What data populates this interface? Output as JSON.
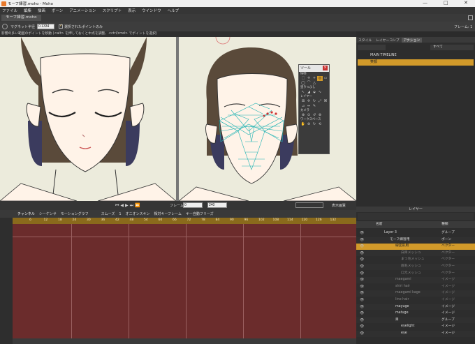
{
  "titlebar": {
    "title": "モーフ練習.moho - Moho",
    "minimize": "—",
    "maximize": "□",
    "close": "✕"
  },
  "menu": [
    "ファイル",
    "編集",
    "描画",
    "ボーン",
    "アニメーション",
    "スクリプト",
    "表示",
    "ウインドウ",
    "ヘルプ"
  ],
  "doc_tab": "モーフ練習.moho",
  "tool_options": {
    "magnet_label": "マグネット半径",
    "magnet_value": "0.1334",
    "selected_only_label": "選択されたポイントのみ"
  },
  "status_text": "影響の多い範囲のポイントを移動 (<alt> を押しておくと中点を調整、<ctrl/cmd> でポイントを選択)",
  "frame_readout": "フレーム: 1",
  "viewport_ctrl": {
    "frame_label": "フレーム",
    "frame_value": "0",
    "end_value": "240",
    "quality": "表示画質"
  },
  "timeline_tabs": [
    "チャンネル",
    "シーケンサ",
    "モーショングラフ",
    "スムーズ",
    "1",
    "オニオンスキン",
    "相対キーフレーム",
    "キー自動フリーズ"
  ],
  "ruler_ticks": [
    "6",
    "12",
    "18",
    "24",
    "30",
    "36",
    "42",
    "48",
    "54",
    "60",
    "66",
    "72",
    "78",
    "84",
    "90",
    "96",
    "102",
    "108",
    "114",
    "120",
    "126",
    "132"
  ],
  "right_tabs": [
    "スタイル",
    "レイヤーコンプ",
    "アクション"
  ],
  "actions": {
    "filter": "すべて",
    "main": "MAIN TIMELINE",
    "selected": "笑顔"
  },
  "layers_panel": {
    "title": "レイヤー",
    "col_name": "名前",
    "col_type": "種類"
  },
  "layers": [
    {
      "name": "Layer 3",
      "type": "グループ",
      "indent": 0,
      "highlight": false,
      "dim": false
    },
    {
      "name": "モーフ練習用",
      "type": "ボーン",
      "indent": 1,
      "highlight": false,
      "dim": false
    },
    {
      "name": "線変形用",
      "type": "ベクター",
      "indent": 2,
      "highlight": true,
      "dim": false
    },
    {
      "name": "白目メッシュ",
      "type": "ベクター",
      "indent": 3,
      "highlight": false,
      "dim": true
    },
    {
      "name": "まつ毛メッシュ",
      "type": "ベクター",
      "indent": 3,
      "highlight": false,
      "dim": true
    },
    {
      "name": "眉毛メッシュ",
      "type": "ベクター",
      "indent": 3,
      "highlight": false,
      "dim": true
    },
    {
      "name": "口元メッシュ",
      "type": "ベクター",
      "indent": 3,
      "highlight": false,
      "dim": true
    },
    {
      "name": "maegami",
      "type": "イメージ",
      "indent": 2,
      "highlight": false,
      "dim": true
    },
    {
      "name": "shiri hair",
      "type": "イメージ",
      "indent": 2,
      "highlight": false,
      "dim": true
    },
    {
      "name": "maegami kage",
      "type": "イメージ",
      "indent": 2,
      "highlight": false,
      "dim": true
    },
    {
      "name": "line hair",
      "type": "イメージ",
      "indent": 2,
      "highlight": false,
      "dim": true
    },
    {
      "name": "mayuge",
      "type": "イメージ",
      "indent": 2,
      "highlight": false,
      "dim": false
    },
    {
      "name": "matuge",
      "type": "イメージ",
      "indent": 2,
      "highlight": false,
      "dim": false
    },
    {
      "name": "目",
      "type": "グループ",
      "indent": 2,
      "highlight": false,
      "dim": false
    },
    {
      "name": "eyelight",
      "type": "イメージ",
      "indent": 3,
      "highlight": false,
      "dim": false
    },
    {
      "name": "eye",
      "type": "イメージ",
      "indent": 3,
      "highlight": false,
      "dim": false
    }
  ],
  "toolbox": {
    "title": "ツール",
    "sections": [
      "描画",
      "塗りつぶし",
      "レイヤー",
      "カメラ",
      "ワークスペース"
    ],
    "close": "×"
  },
  "colors": {
    "accent": "#d29a2a",
    "timeline_bg": "#6b2c2c",
    "viewport_bg": "#ecebdc"
  }
}
